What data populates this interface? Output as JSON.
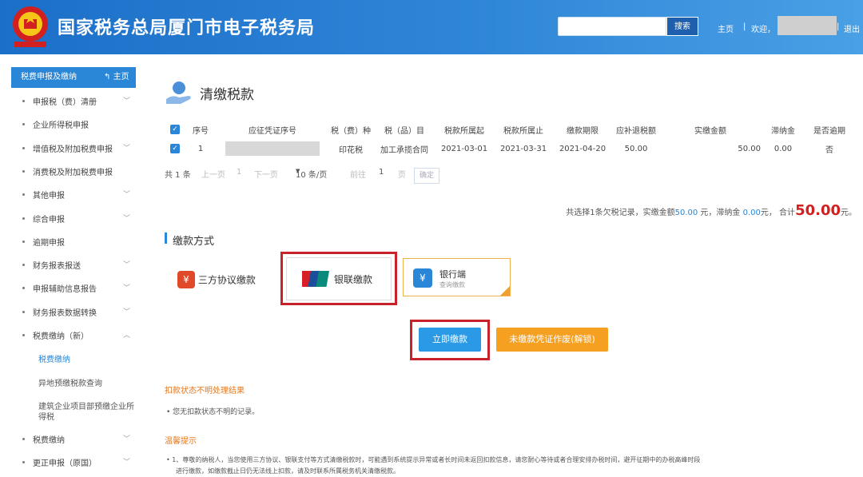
{
  "header": {
    "title": "国家税务总局厦门市电子税务局",
    "search_placeholder": "",
    "search_label": "搜索",
    "home_link": "主页",
    "separator": "|",
    "welcome": "欢迎，",
    "logout": "退出"
  },
  "sidebar": {
    "top_label": "税费申报及缴纳",
    "home_label": "主页",
    "items": [
      {
        "label": "申报税（费）清册",
        "expandable": true
      },
      {
        "label": "企业所得税申报",
        "expandable": false
      },
      {
        "label": "增值税及附加税费申报",
        "expandable": true
      },
      {
        "label": "消费税及附加税费申报",
        "expandable": false
      },
      {
        "label": "其他申报",
        "expandable": true
      },
      {
        "label": "综合申报",
        "expandable": true
      },
      {
        "label": "逾期申报",
        "expandable": false
      },
      {
        "label": "财务报表报送",
        "expandable": true
      },
      {
        "label": "申报辅助信息报告",
        "expandable": true
      },
      {
        "label": "财务报表数据转换",
        "expandable": true
      },
      {
        "label": "税费缴纳（新）",
        "expandable": true
      }
    ],
    "sub_items": [
      "税费缴纳",
      "异地预缴税款查询",
      "建筑企业项目部预缴企业所",
      "得税"
    ],
    "items_after": [
      {
        "label": "税费缴纳",
        "expandable": true
      },
      {
        "label": "更正申报（原国）",
        "expandable": true
      }
    ]
  },
  "page": {
    "title": "清缴税款"
  },
  "table": {
    "columns": [
      "序号",
      "应征凭证序号",
      "税（费）种",
      "税（品）目",
      "税款所属起",
      "税款所属止",
      "缴款期限",
      "应补退税额",
      "实缴金额",
      "滞纳金",
      "是否逾期"
    ],
    "rows": [
      {
        "index": "1",
        "voucher": "",
        "tax_type": "印花税",
        "item": "加工承揽合同",
        "period_start": "2021-03-01",
        "period_end": "2021-03-31",
        "deadline": "2021-04-20",
        "amount_due": "50.00",
        "paid": "50.00",
        "late_fee": "0.00",
        "overdue": "否"
      }
    ]
  },
  "pager": {
    "total": "共 1 条",
    "prev": "上一页",
    "page_one": "1",
    "next": "下一页",
    "per_page": "10 条/页",
    "goto": "前往",
    "page_input": "1",
    "page_unit": "页",
    "confirm": "确定"
  },
  "summary": {
    "text1": "共选择1条欠税记录，实缴金额",
    "paid": "50.00",
    "text2": " 元，滞纳金 ",
    "late": "0.00",
    "text3": "元， 合计",
    "total": "50.00",
    "text4": "元。"
  },
  "payment": {
    "section_title": "缴款方式",
    "option1": "三方协议缴款",
    "option2": "银联缴款",
    "option3_title": "银行端",
    "option3_sub": "查询缴款",
    "pay_now": "立即缴款",
    "void_btn": "未缴款凭证作废(解锁)"
  },
  "notes": {
    "heading1": "扣款状态不明处理结果",
    "bullet1": "•  您无扣款状态不明的记录。",
    "heading2": "温馨提示",
    "bullet2": "•        1、尊敬的纳税人，当您使用三方协议、银联支付等方式清缴税款时，可能遇到系统提示异常或者长时间未返回扣款信息，请您耐心等待或者合理安排办税时间，避开征期中的办税高峰时段",
    "bullet2b": "进行缴款，如缴款截止日仍无法线上扣款，请及时联系所属税务机关清缴税款。"
  },
  "colors": {
    "accent": "#2a86d6",
    "warning": "#f5a020",
    "highlight_frame": "#c8222a",
    "total": "#d21f1f"
  }
}
